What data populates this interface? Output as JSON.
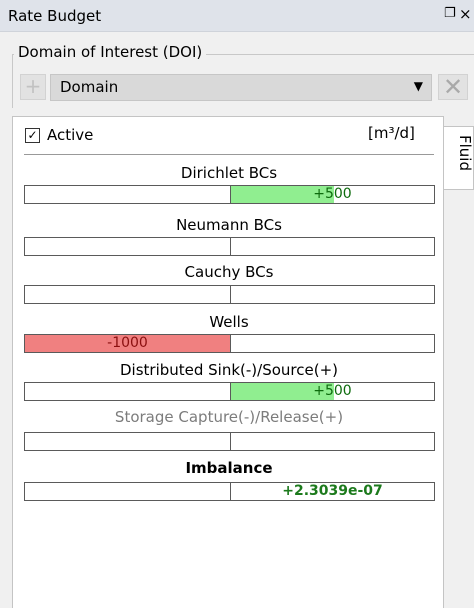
{
  "panel": {
    "title": "Rate Budget",
    "pin_icon": "🗗",
    "close_icon": "×"
  },
  "doi": {
    "legend": "Domain of Interest (DOI)",
    "selected": "Domain",
    "add_icon": "+",
    "caret_icon": "▼",
    "clear_icon": "✕"
  },
  "side_tab": {
    "label": "Fluid"
  },
  "budget": {
    "active_label": "Active",
    "active_checked": true,
    "unit": "[m³/d]",
    "rows": [
      {
        "label": "Dirichlet BCs",
        "value": 500,
        "display": "+500"
      },
      {
        "label": "Neumann BCs",
        "value": 0,
        "display": ""
      },
      {
        "label": "Cauchy BCs",
        "value": 0,
        "display": ""
      },
      {
        "label": "Wells",
        "value": -1000,
        "display": "-1000"
      },
      {
        "label": "Distributed Sink(-)/Source(+)",
        "value": 500,
        "display": "+500"
      },
      {
        "label": "Storage Capture(-)/Release(+)",
        "value": 0,
        "display": ""
      }
    ],
    "imbalance": {
      "label": "Imbalance",
      "value": 2.3039e-07,
      "display": "+2.3039e-07"
    },
    "scale_max": 1000,
    "colors": {
      "positive": "#90ee90",
      "negative": "#f08080"
    }
  }
}
